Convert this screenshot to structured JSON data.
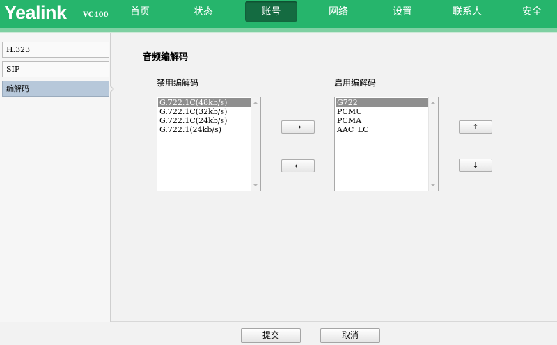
{
  "brand": {
    "logo": "Yealink",
    "model": "VC400"
  },
  "nav": {
    "items": [
      {
        "label": "首页"
      },
      {
        "label": "状态"
      },
      {
        "label": "账号",
        "active": true
      },
      {
        "label": "网络"
      },
      {
        "label": "设置"
      },
      {
        "label": "联系人"
      },
      {
        "label": "安全"
      }
    ]
  },
  "sidebar": {
    "items": [
      {
        "label": "H.323"
      },
      {
        "label": "SIP"
      },
      {
        "label": "编解码",
        "active": true
      }
    ]
  },
  "main": {
    "section_title": "音频编解码",
    "disabled": {
      "label": "禁用编解码",
      "options": [
        "G.722.1C(48kb/s)",
        "G.722.1C(32kb/s)",
        "G.722.1C(24kb/s)",
        "G.722.1(24kb/s)"
      ],
      "selected": "G.722.1C(48kb/s)"
    },
    "enabled": {
      "label": "启用编解码",
      "options": [
        "G722",
        "PCMU",
        "PCMA",
        "AAC_LC"
      ],
      "selected": "G722"
    },
    "buttons": {
      "move_right": "→",
      "move_left": "←",
      "move_up": "↑",
      "move_down": "↓"
    }
  },
  "footer": {
    "submit": "提交",
    "cancel": "取消"
  },
  "colors": {
    "nav_bg": "#26b56c",
    "nav_active": "#146b41",
    "sidebar_active": "#b7c8da"
  }
}
